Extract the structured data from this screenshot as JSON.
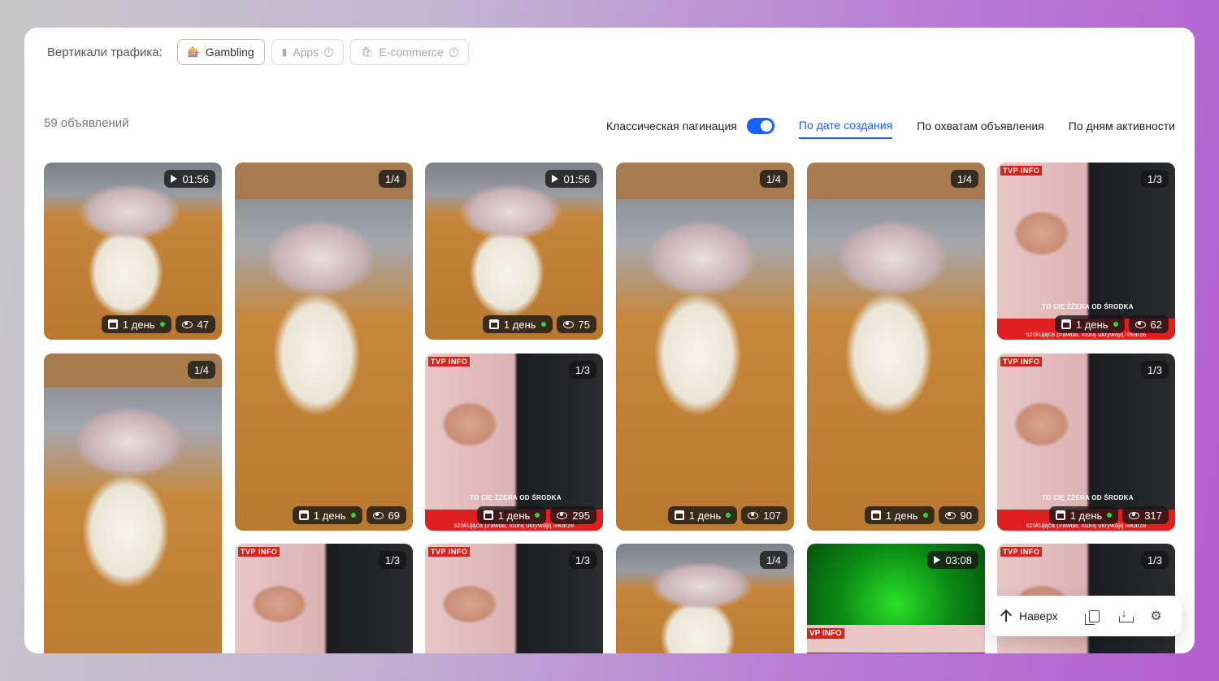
{
  "verticals": {
    "label": "Вертикали трафика:",
    "chips": [
      {
        "label": "Gambling",
        "icon": "casino-icon",
        "active": true
      },
      {
        "label": "Apps",
        "icon": "phone-icon",
        "active": false
      },
      {
        "label": "E-commerce",
        "icon": "shopping-bag-icon",
        "active": false
      }
    ]
  },
  "results": {
    "count_label": "59 объявлений"
  },
  "controls": {
    "pagination_label": "Классическая пагинация",
    "pagination_enabled": true,
    "sort_options": [
      "По дате создания",
      "По охватам объявления",
      "По дням активности"
    ],
    "active_sort": "По дате создания"
  },
  "colors": {
    "accent": "#1a5fff",
    "status_dot": "#2ed14a",
    "tvp_red": "#d0261b"
  },
  "cards": [
    {
      "id": "c1",
      "badge": "01:56",
      "badge_type": "video",
      "days": "1 день",
      "views": "47"
    },
    {
      "id": "c2",
      "badge": "1/4",
      "badge_type": "carousel",
      "days": "1 день",
      "views": "69"
    },
    {
      "id": "c3",
      "badge": "01:56",
      "badge_type": "video",
      "days": "1 день",
      "views": "75"
    },
    {
      "id": "c4",
      "badge": "1/4",
      "badge_type": "carousel",
      "days": "1 день",
      "views": "107"
    },
    {
      "id": "c5",
      "badge": "1/4",
      "badge_type": "carousel",
      "days": "1 день",
      "views": "90"
    },
    {
      "id": "c6",
      "badge": "1/3",
      "badge_type": "carousel",
      "days": "1 день",
      "views": "62",
      "tvp": "TVP INFO",
      "tv_line": "TO CIĘ ŻŻERA OD ŚRODKA",
      "tv_caption": "szokująca prawda, którą ukrywają lekarze"
    },
    {
      "id": "c7",
      "badge": "1/4",
      "badge_type": "carousel"
    },
    {
      "id": "c8",
      "badge": "1/3",
      "badge_type": "carousel",
      "days": "1 день",
      "views": "295",
      "tvp": "TVP INFO",
      "tv_line": "TO CIĘ ŻŻERA OD ŚRODKA",
      "tv_caption": "szokująca prawda, którą ukrywają lekarze"
    },
    {
      "id": "c9",
      "badge": "1/3",
      "badge_type": "carousel",
      "days": "1 день",
      "views": "317",
      "tvp": "TVP INFO",
      "tv_line": "TO CIĘ ŻŻERA OD ŚRODKA",
      "tv_caption": "szokująca prawda, którą ukrywają lekarze"
    },
    {
      "id": "c10",
      "badge": "1/3",
      "badge_type": "carousel",
      "tvp": "TVP INFO"
    },
    {
      "id": "c11",
      "badge": "1/3",
      "badge_type": "carousel",
      "tvp": "TVP INFO"
    },
    {
      "id": "c12",
      "badge": "1/4",
      "badge_type": "carousel"
    },
    {
      "id": "c13",
      "badge": "03:08",
      "badge_type": "video",
      "tvp": "VP INFO"
    },
    {
      "id": "c14",
      "badge": "1/3",
      "badge_type": "carousel",
      "tvp": "TVP INFO"
    }
  ],
  "floating": {
    "up_label": "Наверх"
  }
}
